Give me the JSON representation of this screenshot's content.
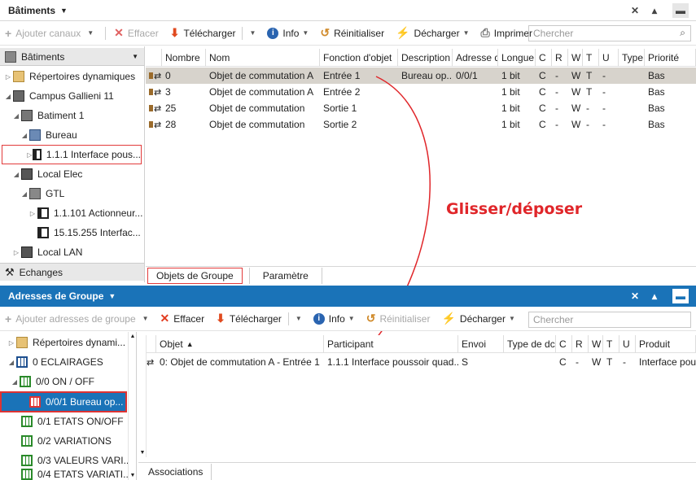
{
  "top": {
    "title": "Bâtiments",
    "toolbar": {
      "add": "Ajouter canaux",
      "delete": "Effacer",
      "download": "Télécharger",
      "info": "Info",
      "reset": "Réinitialiser",
      "unload": "Décharger",
      "print": "Imprimer"
    },
    "search_placeholder": "Chercher",
    "tree_header": "Bâtiments",
    "tree": [
      {
        "label": "Répertoires dynamiques"
      },
      {
        "label": "Campus Gallieni 11"
      },
      {
        "label": "Batiment 1"
      },
      {
        "label": "Bureau"
      },
      {
        "label": "1.1.1 Interface pous..."
      },
      {
        "label": "Local Elec"
      },
      {
        "label": "GTL"
      },
      {
        "label": "1.1.101 Actionneur..."
      },
      {
        "label": "15.15.255 Interfac..."
      },
      {
        "label": "Local LAN"
      }
    ],
    "tree_footer": "Echanges",
    "columns": [
      "Nombre",
      "Nom",
      "Fonction d'objet",
      "Description",
      "Adresse d",
      "Longue",
      "C",
      "R",
      "W",
      "T",
      "U",
      "Type",
      "Priorité"
    ],
    "rows": [
      [
        "0",
        "Objet de commutation A",
        "Entrée 1",
        "Bureau op...",
        "0/0/1",
        "1 bit",
        "C",
        "-",
        "W",
        "T",
        "-",
        "",
        "Bas"
      ],
      [
        "3",
        "Objet de commutation A",
        "Entrée 2",
        "",
        "",
        "1 bit",
        "C",
        "-",
        "W",
        "T",
        "-",
        "",
        "Bas"
      ],
      [
        "25",
        "Objet de commutation",
        "Sortie 1",
        "",
        "",
        "1 bit",
        "C",
        "-",
        "W",
        "-",
        "-",
        "",
        "Bas"
      ],
      [
        "28",
        "Objet de commutation",
        "Sortie 2",
        "",
        "",
        "1 bit",
        "C",
        "-",
        "W",
        "-",
        "-",
        "",
        "Bas"
      ]
    ],
    "tabs": [
      "Objets de Groupe",
      "Paramètre"
    ]
  },
  "annotation": "Glisser/déposer",
  "bottom": {
    "title": "Adresses de Groupe",
    "toolbar": {
      "add": "Ajouter adresses de groupe",
      "delete": "Effacer",
      "download": "Télécharger",
      "info": "Info",
      "reset": "Réinitialiser",
      "unload": "Décharger"
    },
    "search_placeholder": "Chercher",
    "tree": [
      {
        "label": "Répertoires dynami..."
      },
      {
        "label": "0 ECLAIRAGES"
      },
      {
        "label": "0/0 ON / OFF"
      },
      {
        "label": "0/0/1 Bureau op..."
      },
      {
        "label": "0/1 ETATS ON/OFF"
      },
      {
        "label": "0/2 VARIATIONS"
      },
      {
        "label": "0/3 VALEURS VARI..."
      },
      {
        "label": "0/4 ETATS VARIATI..."
      }
    ],
    "columns": [
      "Objet",
      "Participant",
      "Envoi",
      "Type de dc",
      "C",
      "R",
      "W",
      "T",
      "U",
      "Produit"
    ],
    "rows": [
      [
        "0: Objet de commutation A - Entrée 1",
        "1.1.1 Interface poussoir quad...",
        "S",
        "",
        "C",
        "-",
        "W",
        "T",
        "-",
        "Interface pous"
      ]
    ],
    "footer_tab": "Associations"
  },
  "colors": {
    "accent": "#1a73b8",
    "highlight_red": "#e23b3b",
    "row_highlight": "#d7d3cc"
  }
}
